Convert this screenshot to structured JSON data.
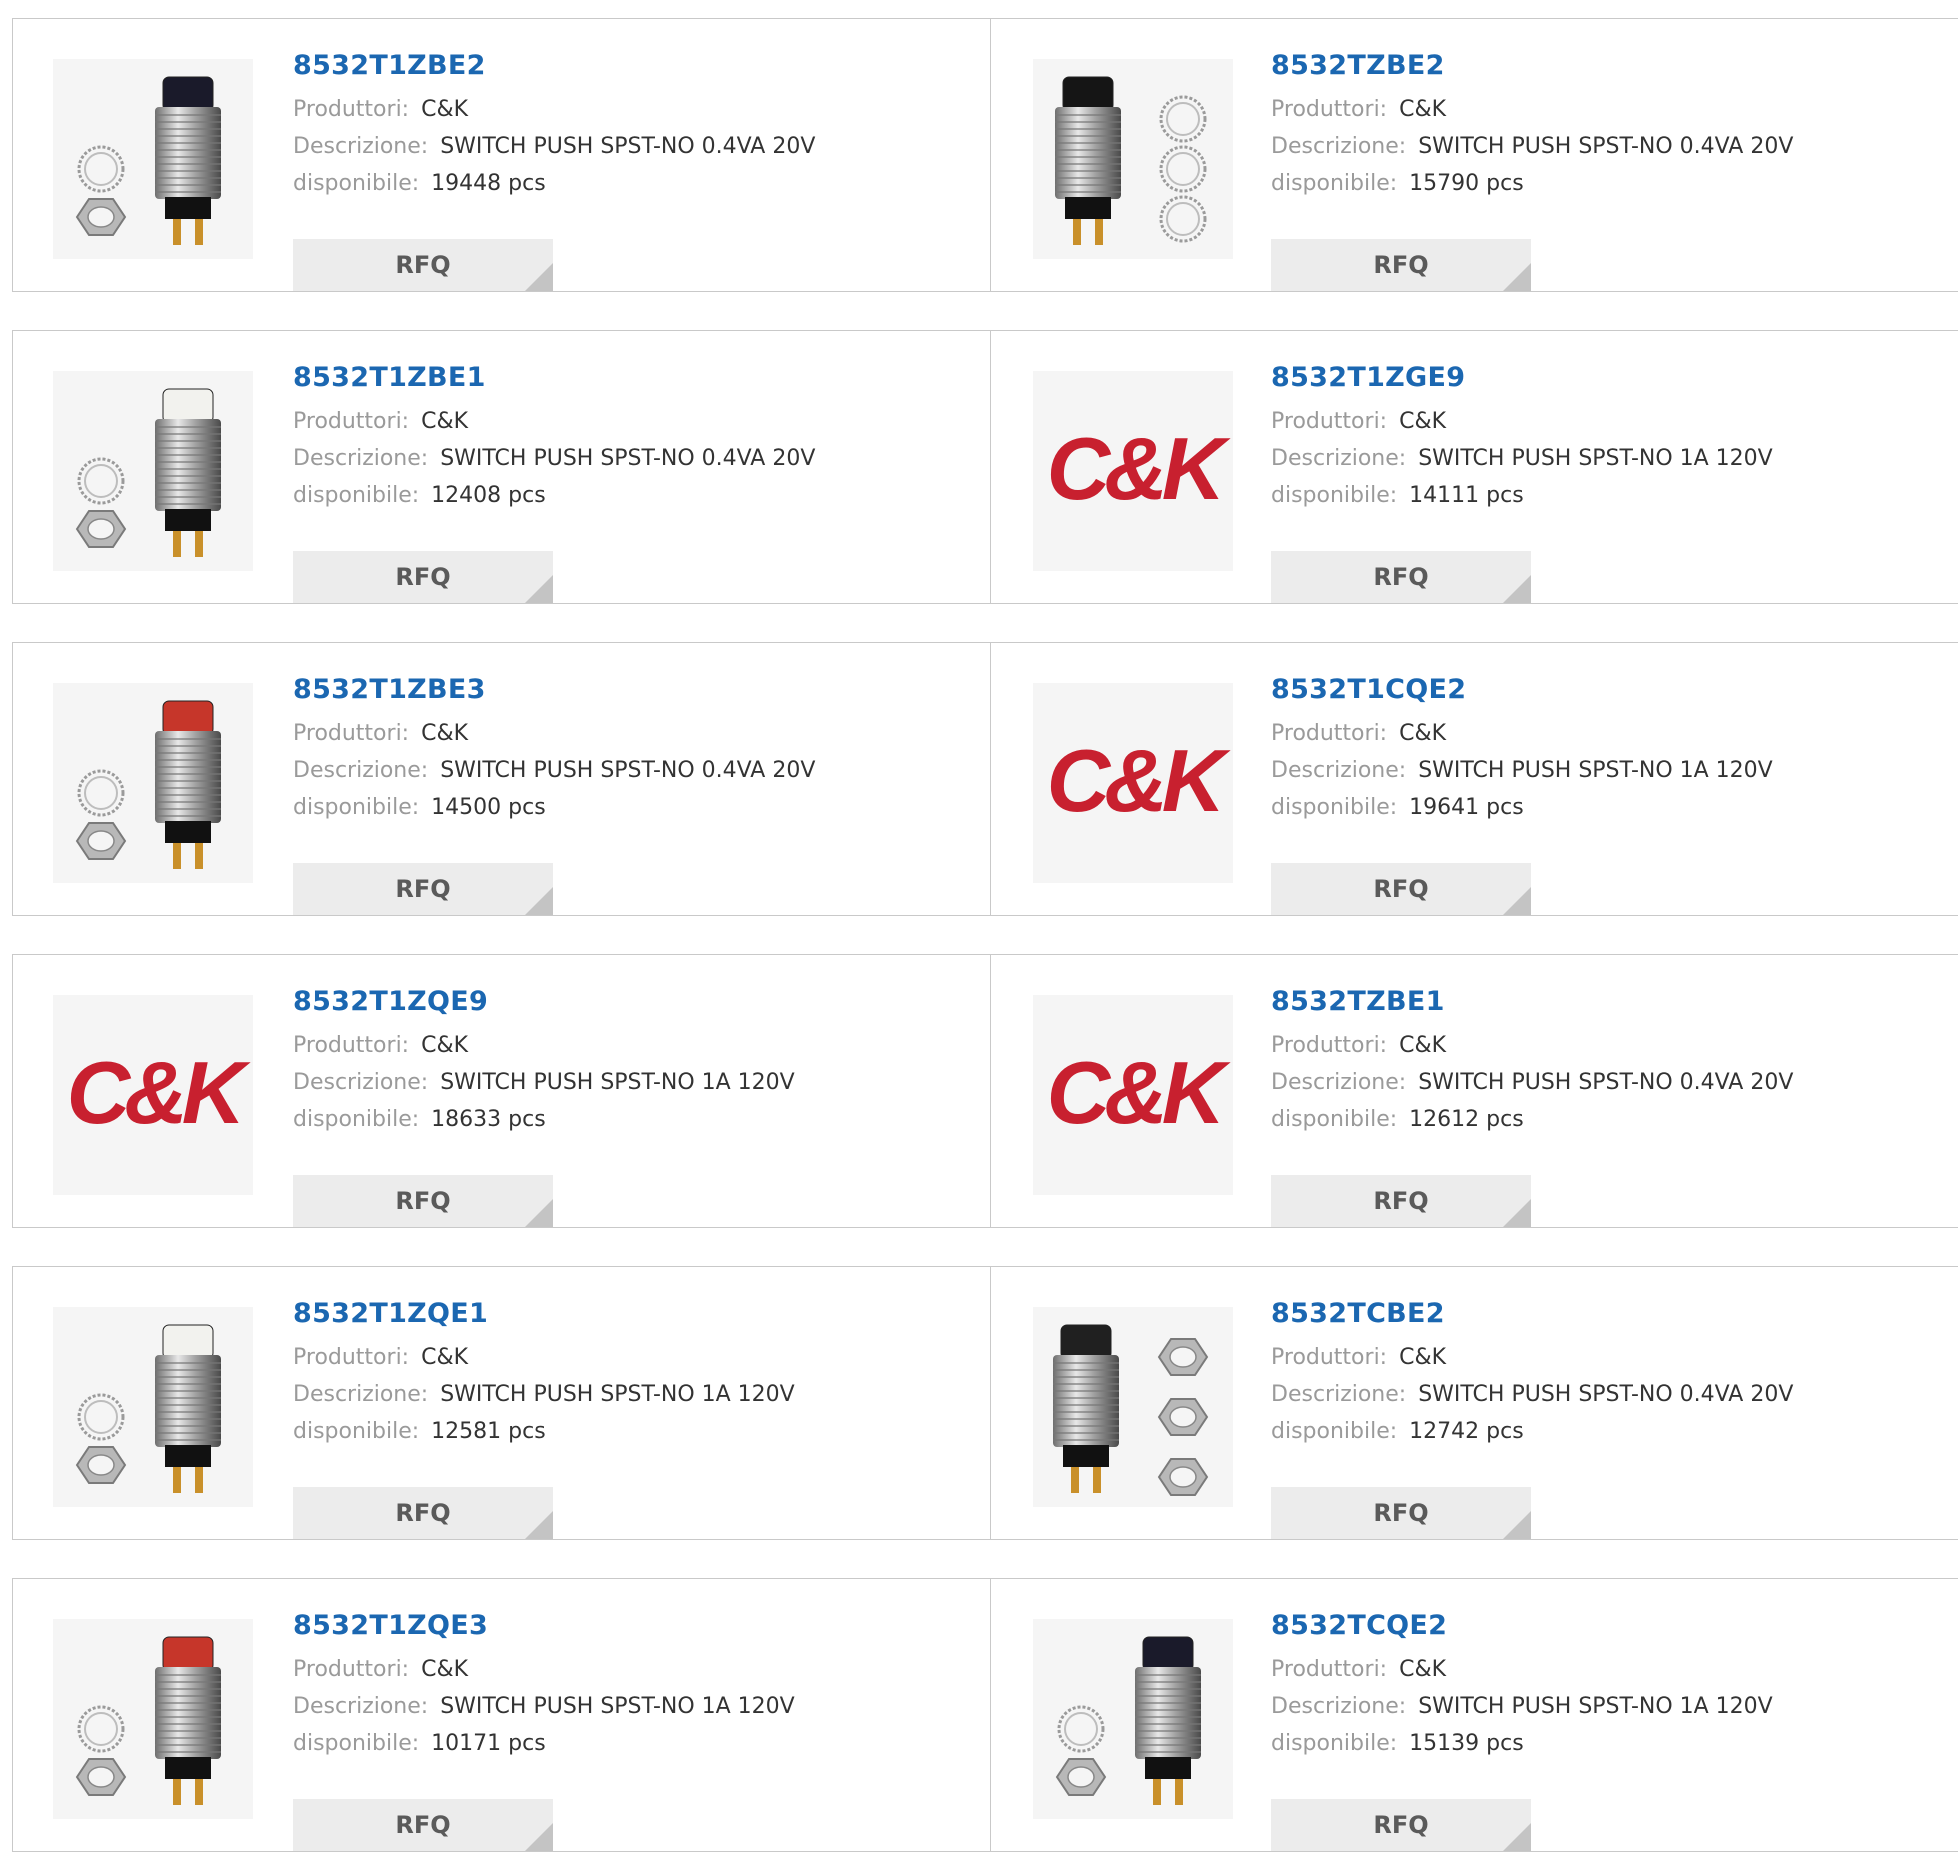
{
  "labels": {
    "manufacturer": "Produttori:",
    "description": "Descrizione:",
    "available": "disponibile:",
    "rfq": "RFQ"
  },
  "colors": {
    "part_link": "#1b67b1",
    "label": "#9a9a9a",
    "value": "#333333",
    "button_bg": "#ececec",
    "logo_red": "#c8202f"
  },
  "products": [
    {
      "part": "8532T1ZBE2",
      "manufacturer": "C&K",
      "description": "SWITCH PUSH SPST-NO 0.4VA 20V",
      "stock": "19448 pcs",
      "image": "pushbutton-black-icon"
    },
    {
      "part": "8532TZBE2",
      "manufacturer": "C&K",
      "description": "SWITCH PUSH SPST-NO 0.4VA 20V",
      "stock": "15790 pcs",
      "image": "pushbutton-rings-icon"
    },
    {
      "part": "8532T1ZBE1",
      "manufacturer": "C&K",
      "description": "SWITCH PUSH SPST-NO 0.4VA 20V",
      "stock": "12408 pcs",
      "image": "pushbutton-white-icon"
    },
    {
      "part": "8532T1ZGE9",
      "manufacturer": "C&K",
      "description": "SWITCH PUSH SPST-NO 1A 120V",
      "stock": "14111 pcs",
      "image": "ck-logo",
      "logo_text": "C&K"
    },
    {
      "part": "8532T1ZBE3",
      "manufacturer": "C&K",
      "description": "SWITCH PUSH SPST-NO 0.4VA 20V",
      "stock": "14500 pcs",
      "image": "pushbutton-red-icon"
    },
    {
      "part": "8532T1CQE2",
      "manufacturer": "C&K",
      "description": "SWITCH PUSH SPST-NO 1A 120V",
      "stock": "19641 pcs",
      "image": "ck-logo",
      "logo_text": "C&K"
    },
    {
      "part": "8532T1ZQE9",
      "manufacturer": "C&K",
      "description": "SWITCH PUSH SPST-NO 1A 120V",
      "stock": "18633 pcs",
      "image": "ck-logo",
      "logo_text": "C&K"
    },
    {
      "part": "8532TZBE1",
      "manufacturer": "C&K",
      "description": "SWITCH PUSH SPST-NO 0.4VA 20V",
      "stock": "12612 pcs",
      "image": "ck-logo",
      "logo_text": "C&K"
    },
    {
      "part": "8532T1ZQE1",
      "manufacturer": "C&K",
      "description": "SWITCH PUSH SPST-NO 1A 120V",
      "stock": "12581 pcs",
      "image": "pushbutton-white-icon"
    },
    {
      "part": "8532TCBE2",
      "manufacturer": "C&K",
      "description": "SWITCH PUSH SPST-NO 0.4VA 20V",
      "stock": "12742 pcs",
      "image": "pushbutton-hexnuts-icon"
    },
    {
      "part": "8532T1ZQE3",
      "manufacturer": "C&K",
      "description": "SWITCH PUSH SPST-NO 1A 120V",
      "stock": "10171 pcs",
      "image": "pushbutton-red-icon"
    },
    {
      "part": "8532TCQE2",
      "manufacturer": "C&K",
      "description": "SWITCH PUSH SPST-NO 1A 120V",
      "stock": "15139 pcs",
      "image": "pushbutton-black-icon"
    }
  ]
}
